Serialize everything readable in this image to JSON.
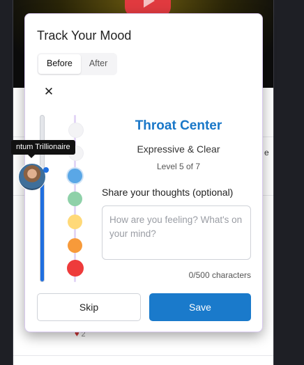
{
  "modal": {
    "title": "Track Your Mood",
    "tabs": [
      {
        "label": "Before",
        "active": true
      },
      {
        "label": "After",
        "active": false
      }
    ],
    "close_icon": "close-icon",
    "slider_level_fraction": 0.65,
    "mood_levels": [
      {
        "color": "#f3f3f5",
        "selected": false
      },
      {
        "color": "#f3f3f5",
        "selected": false
      },
      {
        "color": "#5aa7e6",
        "selected": true
      },
      {
        "color": "#8fd1a9",
        "selected": false
      },
      {
        "color": "#ffd978",
        "selected": false
      },
      {
        "color": "#f79a3a",
        "selected": false
      },
      {
        "color": "#ee3b3b",
        "selected": false
      }
    ],
    "center": {
      "title": "Throat Center",
      "subtitle": "Expressive & Clear",
      "level_text": "Level 5 of 7",
      "accent_color": "#1977c8"
    },
    "thoughts": {
      "label": "Share your thoughts (optional)",
      "value": "",
      "placeholder": "How are you feeling? What's on your mind?",
      "char_count": "0/500 characters"
    },
    "buttons": {
      "skip_label": "Skip",
      "save_label": "Save",
      "save_color": "#1a7acb"
    }
  },
  "tooltip": {
    "text": "ntum Trillionaire"
  },
  "background": {
    "side_text": "e",
    "like_count": "2"
  }
}
